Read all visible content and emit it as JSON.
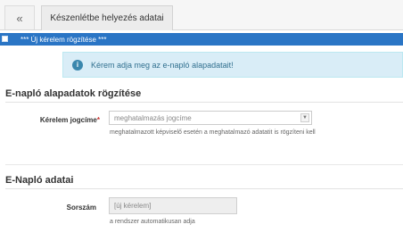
{
  "tabs": {
    "back_label": "«",
    "active_label": "Készenlétbe helyezés adatai"
  },
  "section_bar": {
    "label": "*** Új kérelem rögzítése ***"
  },
  "alert": {
    "icon": "info-icon",
    "icon_glyph": "i",
    "text": "Kérem adja meg az e-napló alapadatait!"
  },
  "basic_section": {
    "title": "E-napló alapadatok rögzítése",
    "kerelem_label": "Kérelem jogcíme",
    "required_mark": "*",
    "select_value": "meghatalmazás jogcíme",
    "select_arrow": "▼",
    "help": "meghatalmazott képviselő esetén a meghatalmazó adatatit is rögzíteni kell"
  },
  "enaplo_section": {
    "title": "E-Napló adatai",
    "sorszam_label": "Sorszám",
    "sorszam_value": "[új kérelem]",
    "help": "a rendszer automatikusan adja"
  },
  "colors": {
    "section_bar": "#2a75c5",
    "alert_bg": "#d9edf7",
    "alert_text": "#31708f",
    "required": "#c9302c"
  }
}
